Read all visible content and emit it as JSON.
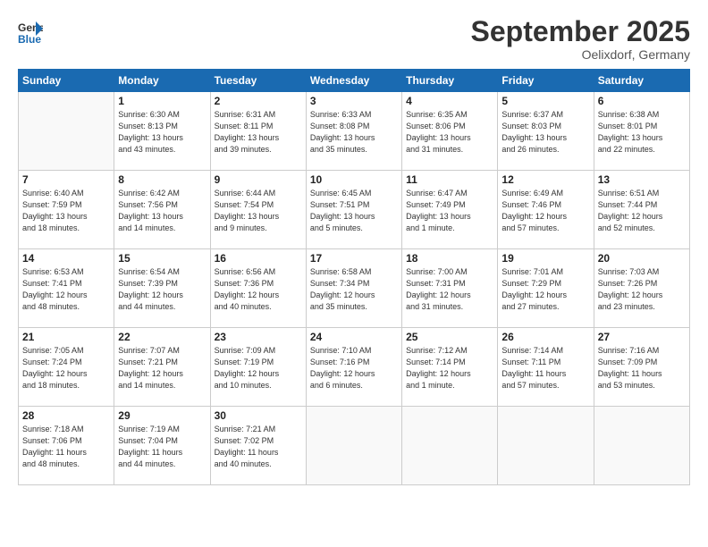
{
  "header": {
    "logo_line1": "General",
    "logo_line2": "Blue",
    "month_title": "September 2025",
    "location": "Oelixdorf, Germany"
  },
  "weekdays": [
    "Sunday",
    "Monday",
    "Tuesday",
    "Wednesday",
    "Thursday",
    "Friday",
    "Saturday"
  ],
  "weeks": [
    [
      {
        "day": "",
        "info": ""
      },
      {
        "day": "1",
        "info": "Sunrise: 6:30 AM\nSunset: 8:13 PM\nDaylight: 13 hours\nand 43 minutes."
      },
      {
        "day": "2",
        "info": "Sunrise: 6:31 AM\nSunset: 8:11 PM\nDaylight: 13 hours\nand 39 minutes."
      },
      {
        "day": "3",
        "info": "Sunrise: 6:33 AM\nSunset: 8:08 PM\nDaylight: 13 hours\nand 35 minutes."
      },
      {
        "day": "4",
        "info": "Sunrise: 6:35 AM\nSunset: 8:06 PM\nDaylight: 13 hours\nand 31 minutes."
      },
      {
        "day": "5",
        "info": "Sunrise: 6:37 AM\nSunset: 8:03 PM\nDaylight: 13 hours\nand 26 minutes."
      },
      {
        "day": "6",
        "info": "Sunrise: 6:38 AM\nSunset: 8:01 PM\nDaylight: 13 hours\nand 22 minutes."
      }
    ],
    [
      {
        "day": "7",
        "info": "Sunrise: 6:40 AM\nSunset: 7:59 PM\nDaylight: 13 hours\nand 18 minutes."
      },
      {
        "day": "8",
        "info": "Sunrise: 6:42 AM\nSunset: 7:56 PM\nDaylight: 13 hours\nand 14 minutes."
      },
      {
        "day": "9",
        "info": "Sunrise: 6:44 AM\nSunset: 7:54 PM\nDaylight: 13 hours\nand 9 minutes."
      },
      {
        "day": "10",
        "info": "Sunrise: 6:45 AM\nSunset: 7:51 PM\nDaylight: 13 hours\nand 5 minutes."
      },
      {
        "day": "11",
        "info": "Sunrise: 6:47 AM\nSunset: 7:49 PM\nDaylight: 13 hours\nand 1 minute."
      },
      {
        "day": "12",
        "info": "Sunrise: 6:49 AM\nSunset: 7:46 PM\nDaylight: 12 hours\nand 57 minutes."
      },
      {
        "day": "13",
        "info": "Sunrise: 6:51 AM\nSunset: 7:44 PM\nDaylight: 12 hours\nand 52 minutes."
      }
    ],
    [
      {
        "day": "14",
        "info": "Sunrise: 6:53 AM\nSunset: 7:41 PM\nDaylight: 12 hours\nand 48 minutes."
      },
      {
        "day": "15",
        "info": "Sunrise: 6:54 AM\nSunset: 7:39 PM\nDaylight: 12 hours\nand 44 minutes."
      },
      {
        "day": "16",
        "info": "Sunrise: 6:56 AM\nSunset: 7:36 PM\nDaylight: 12 hours\nand 40 minutes."
      },
      {
        "day": "17",
        "info": "Sunrise: 6:58 AM\nSunset: 7:34 PM\nDaylight: 12 hours\nand 35 minutes."
      },
      {
        "day": "18",
        "info": "Sunrise: 7:00 AM\nSunset: 7:31 PM\nDaylight: 12 hours\nand 31 minutes."
      },
      {
        "day": "19",
        "info": "Sunrise: 7:01 AM\nSunset: 7:29 PM\nDaylight: 12 hours\nand 27 minutes."
      },
      {
        "day": "20",
        "info": "Sunrise: 7:03 AM\nSunset: 7:26 PM\nDaylight: 12 hours\nand 23 minutes."
      }
    ],
    [
      {
        "day": "21",
        "info": "Sunrise: 7:05 AM\nSunset: 7:24 PM\nDaylight: 12 hours\nand 18 minutes."
      },
      {
        "day": "22",
        "info": "Sunrise: 7:07 AM\nSunset: 7:21 PM\nDaylight: 12 hours\nand 14 minutes."
      },
      {
        "day": "23",
        "info": "Sunrise: 7:09 AM\nSunset: 7:19 PM\nDaylight: 12 hours\nand 10 minutes."
      },
      {
        "day": "24",
        "info": "Sunrise: 7:10 AM\nSunset: 7:16 PM\nDaylight: 12 hours\nand 6 minutes."
      },
      {
        "day": "25",
        "info": "Sunrise: 7:12 AM\nSunset: 7:14 PM\nDaylight: 12 hours\nand 1 minute."
      },
      {
        "day": "26",
        "info": "Sunrise: 7:14 AM\nSunset: 7:11 PM\nDaylight: 11 hours\nand 57 minutes."
      },
      {
        "day": "27",
        "info": "Sunrise: 7:16 AM\nSunset: 7:09 PM\nDaylight: 11 hours\nand 53 minutes."
      }
    ],
    [
      {
        "day": "28",
        "info": "Sunrise: 7:18 AM\nSunset: 7:06 PM\nDaylight: 11 hours\nand 48 minutes."
      },
      {
        "day": "29",
        "info": "Sunrise: 7:19 AM\nSunset: 7:04 PM\nDaylight: 11 hours\nand 44 minutes."
      },
      {
        "day": "30",
        "info": "Sunrise: 7:21 AM\nSunset: 7:02 PM\nDaylight: 11 hours\nand 40 minutes."
      },
      {
        "day": "",
        "info": ""
      },
      {
        "day": "",
        "info": ""
      },
      {
        "day": "",
        "info": ""
      },
      {
        "day": "",
        "info": ""
      }
    ]
  ]
}
